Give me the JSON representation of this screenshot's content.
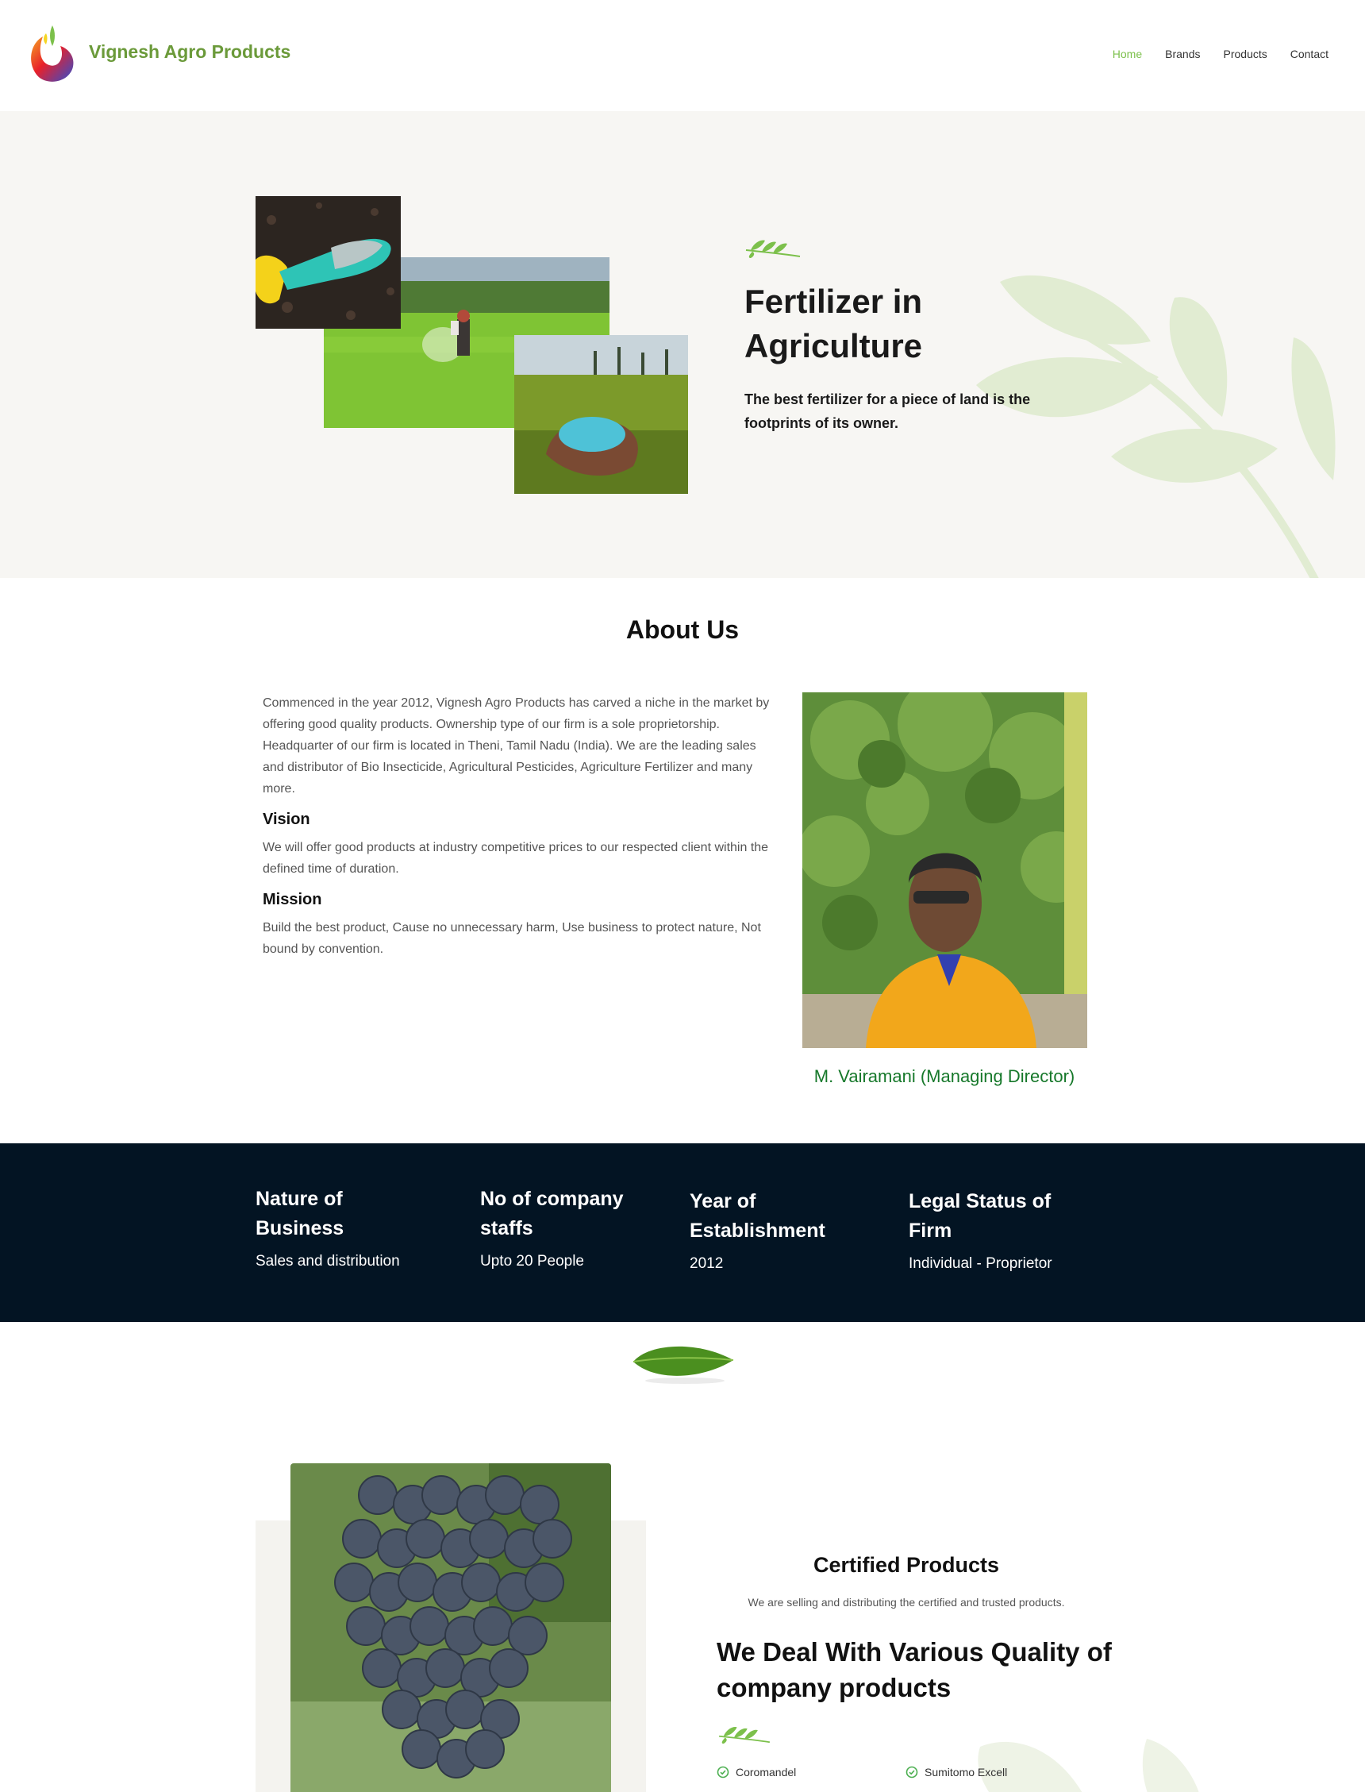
{
  "header": {
    "brand": "Vignesh Agro Products",
    "nav": [
      {
        "label": "Home",
        "active": true
      },
      {
        "label": "Brands",
        "active": false
      },
      {
        "label": "Products",
        "active": false
      },
      {
        "label": "Contact",
        "active": false
      }
    ]
  },
  "hero": {
    "title": "Fertilizer in Agriculture",
    "subtitle": "The best fertilizer for a piece of land is the footprints of its owner."
  },
  "about": {
    "title": "About Us",
    "intro": "Commenced in the year 2012, Vignesh Agro Products has carved a niche in the market by offering good quality products. Ownership type of our firm is a sole proprietorship. Headquarter of our firm is located in Theni, Tamil Nadu (India). We are the leading sales and distributor of Bio Insecticide, Agricultural Pesticides, Agriculture Fertilizer and many more.",
    "vision_heading": "Vision",
    "vision_text": "We will offer good products at industry competitive prices to our respected client within the defined time of duration.",
    "mission_heading": "Mission",
    "mission_text": "Build the best product, Cause no unnecessary harm, Use business to protect nature, Not bound by convention.",
    "director": "M. Vairamani (Managing Director)"
  },
  "stats": [
    {
      "heading": "Nature of Business",
      "value": "Sales and distribution"
    },
    {
      "heading": "No of company staffs",
      "value": "Upto 20 People"
    },
    {
      "heading": "Year of Establishment",
      "value": "2012"
    },
    {
      "heading": "Legal Status of Firm",
      "value": "Individual - Proprietor"
    }
  ],
  "products": {
    "cert_title": "Certified Products",
    "cert_sub": "We are selling and distributing the certified and trusted products.",
    "deal_title": "We Deal With Various Quality of company products",
    "brands": [
      "Coromandel",
      "Sumitomo Excell"
    ]
  },
  "colors": {
    "brand_green": "#6b9a3a",
    "nav_active": "#7cc04b",
    "director_green": "#16782a",
    "stats_bg": "#031423"
  }
}
